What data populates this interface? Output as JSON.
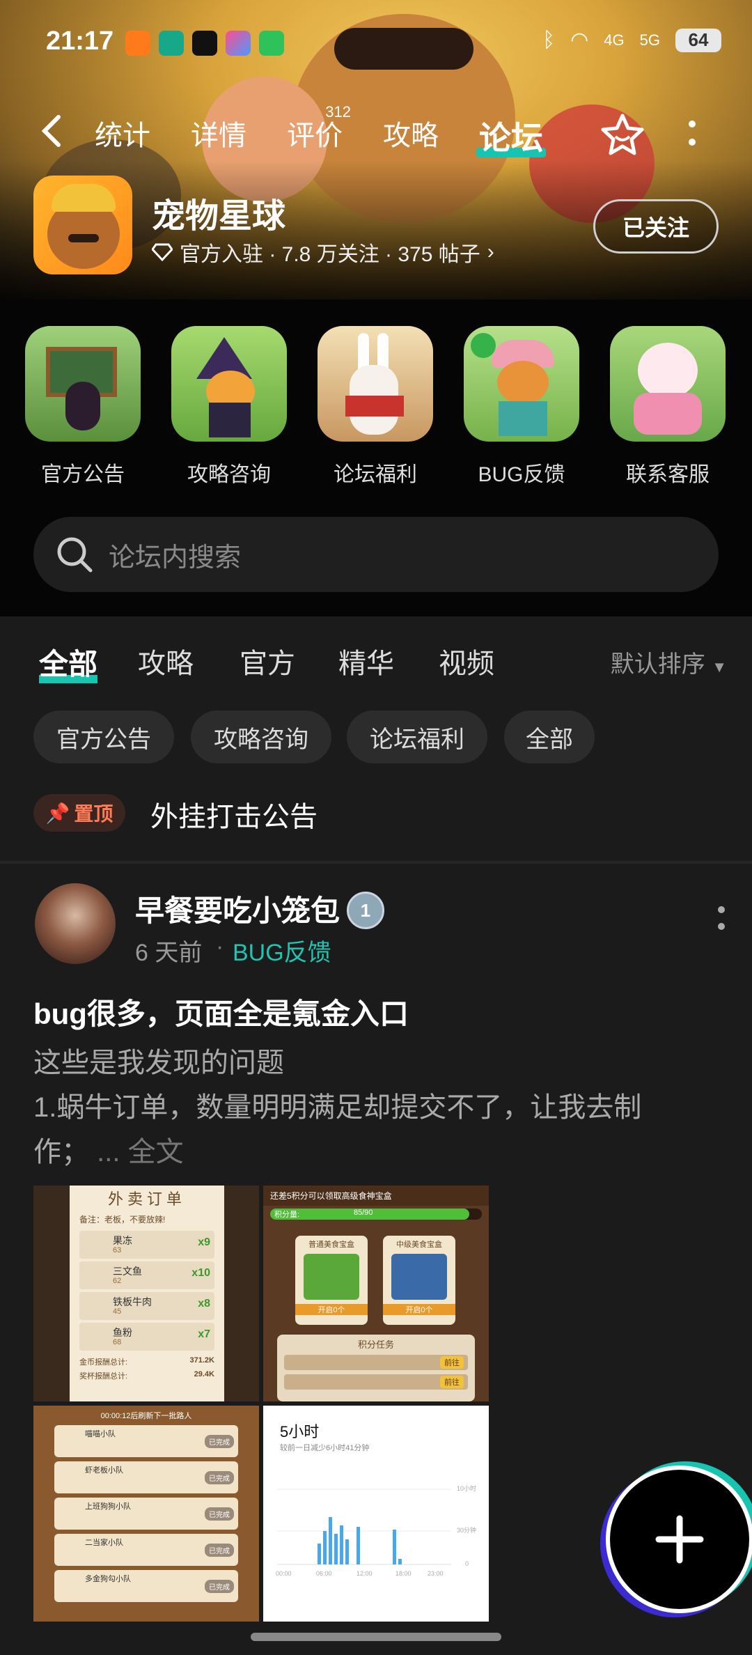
{
  "status_bar": {
    "time": "21:17",
    "signal_4g": "4G",
    "signal_5g": "5G",
    "battery": "64"
  },
  "nav": {
    "tabs": [
      {
        "label": "统计",
        "active": false
      },
      {
        "label": "详情",
        "active": false
      },
      {
        "label": "评价",
        "badge": "312",
        "active": false
      },
      {
        "label": "攻略",
        "active": false
      },
      {
        "label": "论坛",
        "active": true
      }
    ]
  },
  "app": {
    "title": "宠物星球",
    "meta": "官方入驻 · 7.8 万关注 · 375 帖子",
    "follow_label": "已关注"
  },
  "shortcuts": [
    {
      "label": "官方公告"
    },
    {
      "label": "攻略咨询"
    },
    {
      "label": "论坛福利"
    },
    {
      "label": "BUG反馈"
    },
    {
      "label": "联系客服"
    }
  ],
  "search": {
    "placeholder": "论坛内搜索"
  },
  "filter_tabs": [
    "全部",
    "攻略",
    "官方",
    "精华",
    "视频"
  ],
  "sort_label": "默认排序",
  "chips": [
    "官方公告",
    "攻略咨询",
    "论坛福利",
    "全部"
  ],
  "pinned": {
    "badge": "置顶",
    "title": "外挂打击公告"
  },
  "post": {
    "username": "早餐要吃小笼包",
    "level": "1",
    "time": "6 天前",
    "category": "BUG反馈",
    "title": "bug很多，页面全是氪金入口",
    "body_line1": "这些是我发现的问题",
    "body_line2": "1.蜗牛订单，数量明明满足却提交不了，让我去制",
    "body_line3": "作；",
    "read_more": "... 全文",
    "images": {
      "order_panel": {
        "header": "外卖订单",
        "subheader": "备注：老板，不要放辣!",
        "items": [
          {
            "name": "果冻",
            "count": "x9",
            "sub": "63"
          },
          {
            "name": "三文鱼",
            "count": "x10",
            "sub": "62"
          },
          {
            "name": "铁板牛肉",
            "count": "x8",
            "sub": "45"
          },
          {
            "name": "鱼粉",
            "count": "x7",
            "sub": "68"
          }
        ],
        "total1_label": "金币报酬总计:",
        "total1": "371.2K",
        "total2_label": "奖杯报酬总计:",
        "total2": "29.4K"
      },
      "points_panel": {
        "header": "还差5积分可以领取高级食神宝盒",
        "progress_label": "积分量:",
        "progress_text": "85/90",
        "box1": "普通美食宝盒",
        "box2": "中级美食宝盒",
        "open1": "开启0个",
        "open2": "开启0个",
        "task_header": "积分任务",
        "task_btn": "前往"
      },
      "team_panel": {
        "header": "00:00:12后刷新下一批路人",
        "teams": [
          "喵喵小队",
          "虾老板小队",
          "上班狗狗小队",
          "二当家小队",
          "多金狗勾小队"
        ],
        "btn": "已完成"
      },
      "screen_time": {
        "title": "5小时",
        "subtitle": "较前一日减少6小时41分钟",
        "y_labels": [
          "10小时",
          "30分钟",
          "0"
        ],
        "x_labels": [
          "00:00",
          "06:00",
          "12:00",
          "18:00",
          "23:00"
        ]
      }
    }
  },
  "colors": {
    "accent": "#17c4b0",
    "pin": "#ff7a55",
    "bg": "#1b1b1b"
  }
}
